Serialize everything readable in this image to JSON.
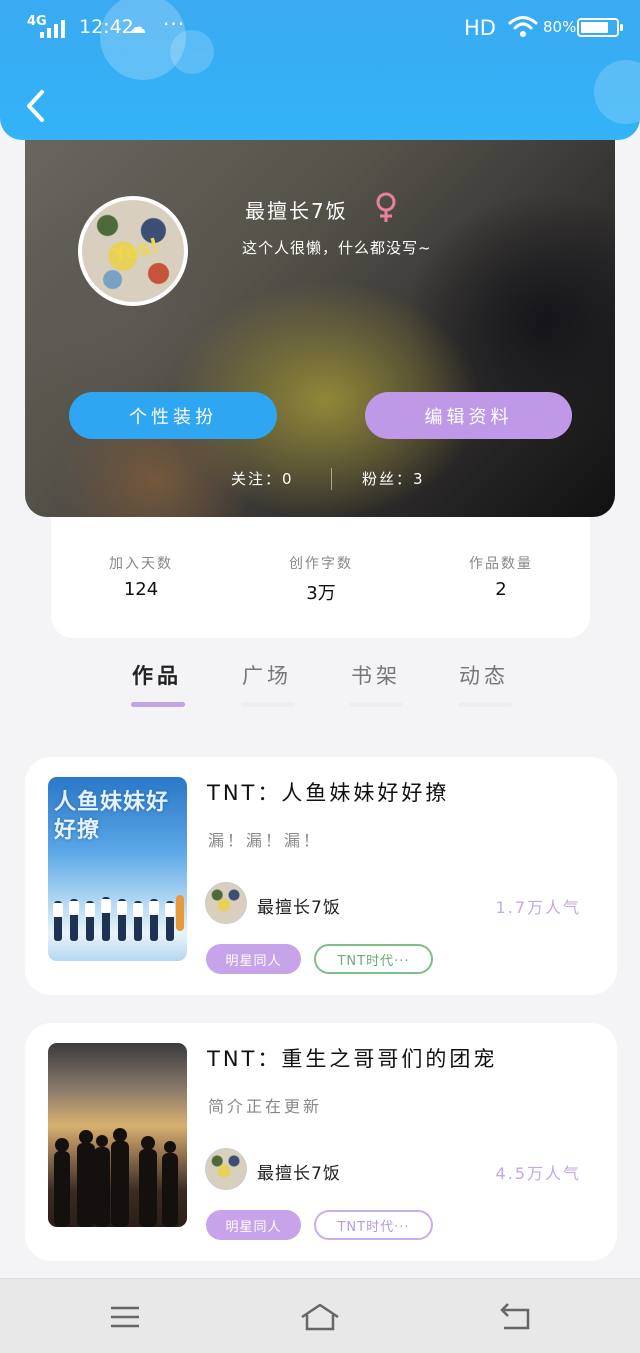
{
  "status_bar": {
    "network": "4G",
    "time": "12:42",
    "dots": "···",
    "hd": "HD",
    "battery_text": "80%",
    "battery_level": 0.8
  },
  "profile": {
    "username": "最擅长7饭",
    "gender": "female",
    "bio": "这个人很懒，什么都没写~",
    "avatar_text": "Yes!",
    "dress_label": "个性装扮",
    "edit_label": "编辑资料",
    "follow_text": "关注：0",
    "fans_text": "粉丝：3"
  },
  "stats": [
    {
      "label": "加入天数",
      "value": "124"
    },
    {
      "label": "创作字数",
      "value": "3万"
    },
    {
      "label": "作品数量",
      "value": "2"
    }
  ],
  "tabs": [
    "作品",
    "广场",
    "书架",
    "动态"
  ],
  "works": [
    {
      "title": "TNT：人鱼妹妹好好撩",
      "description": "漏！漏！漏！",
      "cover_text": "人鱼妹妹好好撩",
      "author": "最擅长7饭",
      "popularity": "1.7万人气",
      "tag_primary": "明星同人",
      "tag_secondary": "TNT时代···"
    },
    {
      "title": "TNT：重生之哥哥们的团宠",
      "description": "简介正在更新",
      "author": "最擅长7饭",
      "popularity": "4.5万人气",
      "tag_primary": "明星同人",
      "tag_secondary": "TNT时代···"
    }
  ],
  "colors": {
    "header": "#33b3f8",
    "dress_button": "#2ea6f1",
    "edit_button": "#bf99e8",
    "accent_purple": "#c1a4e3",
    "tag_green": "#7fbf86"
  },
  "icons": {
    "back": "chevron-left-icon",
    "gender": "female-icon",
    "nav_menu": "menu-icon",
    "nav_home": "home-icon",
    "nav_back": "back-icon"
  }
}
